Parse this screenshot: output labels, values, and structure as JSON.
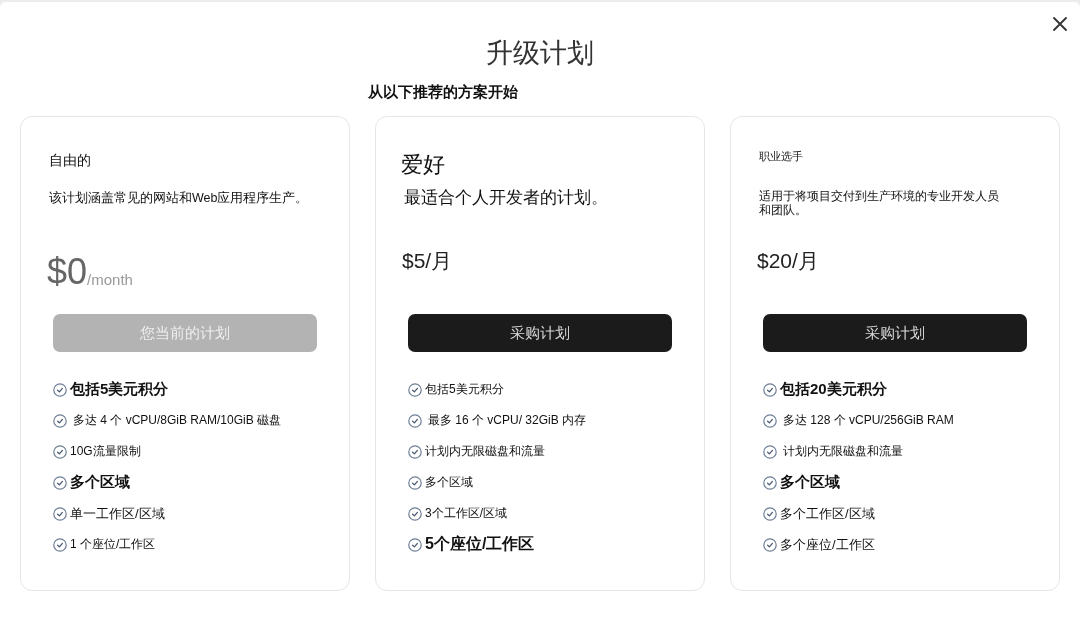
{
  "dialog": {
    "title": "升级计划",
    "subtitle": "从以下推荐的方案开始"
  },
  "plans": [
    {
      "name": "自由的",
      "description": "该计划涵盖常见的网站和Web应用程序生产。",
      "price": "$0",
      "price_unit": "/month",
      "button": "您当前的计划",
      "current": true,
      "features": [
        "包括5美元积分",
        "多达 4 个 vCPU/8GiB RAM/10GiB 磁盘",
        "10G流量限制",
        "多个区域",
        "单一工作区/区域",
        "1 个座位/工作区"
      ]
    },
    {
      "name": "爱好",
      "description": "最适合个人开发者的计划。",
      "price": "$5/月",
      "button": "采购计划",
      "current": false,
      "features": [
        "包括5美元积分",
        "最多 16 个 vCPU/ 32GiB 内存",
        "计划内无限磁盘和流量",
        "多个区域",
        "3个工作区/区域",
        "5个座位/工作区"
      ]
    },
    {
      "name": "职业选手",
      "description": "适用于将项目交付到生产环境的专业开发人员和团队。",
      "price": "$20/月",
      "button": "采购计划",
      "current": false,
      "features": [
        "包括20美元积分",
        "多达 128 个 vCPU/256GiB RAM",
        "计划内无限磁盘和流量",
        "多个区域",
        "多个工作区/区域",
        "多个座位/工作区"
      ]
    }
  ]
}
